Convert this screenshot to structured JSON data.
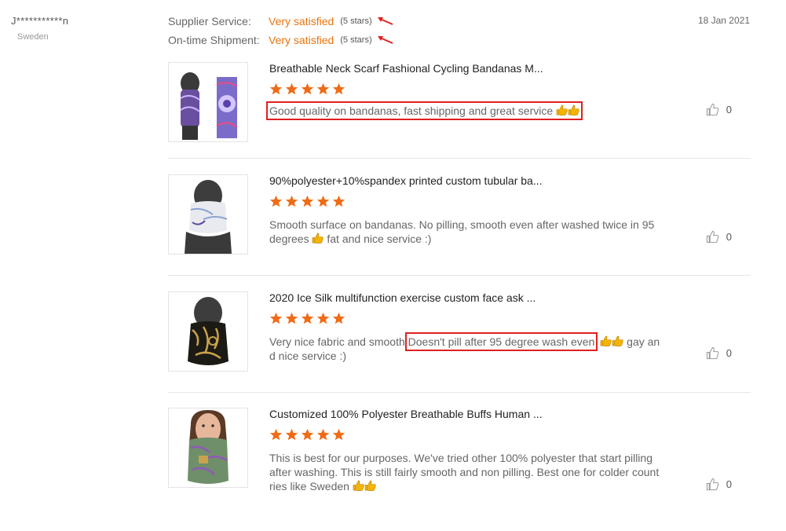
{
  "reviewer": {
    "name": "J***********n",
    "country": "Sweden"
  },
  "ratings": [
    {
      "label": "Supplier Service:",
      "value": "Very satisfied",
      "stars_text": "(5 stars)"
    },
    {
      "label": "On-time Shipment:",
      "value": "Very satisfied",
      "stars_text": "(5 stars)"
    }
  ],
  "date": "18 Jan 2021",
  "colors": {
    "accent": "#e9740f",
    "star": "#f06b15",
    "highlight": "#e02020"
  },
  "products": [
    {
      "title": "Breathable Neck Scarf Fashional Cycling Bandanas M...",
      "rating": 5,
      "text": "Good quality on bandanas, fast shipping and great service",
      "likes": "0"
    },
    {
      "title": "90%polyester+10%spandex printed custom tubular ba...",
      "rating": 5,
      "text": "Smooth surface on bandanas. No pilling, smooth even after washed twice in 95 degrees",
      "text_after": "fat and nice service :)",
      "likes": "0"
    },
    {
      "title": "2020 Ice Silk multifunction exercise custom face ask ...",
      "rating": 5,
      "text_before": "Very nice fabric and smooth",
      "text_highlight": "Doesn't pill after 95 degree wash even",
      "text_after": "gay and nice service :)",
      "likes": "0"
    },
    {
      "title": "Customized 100% Polyester Breathable Buffs Human ...",
      "rating": 5,
      "text": "This is best for our purposes. We've tried other 100% polyester that start pilling after washing. This is still fairly smooth and non pilling. Best one for colder countries like Sweden",
      "likes": "0"
    }
  ]
}
